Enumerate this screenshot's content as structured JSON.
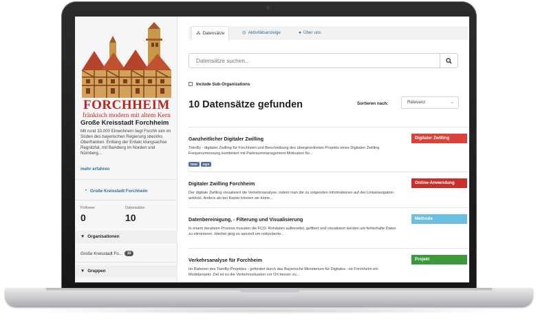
{
  "tabs": [
    {
      "icon": "sitemap-icon",
      "glyph": "⁂",
      "label": "Datensätze"
    },
    {
      "icon": "activity-icon",
      "glyph": "◎",
      "label": "Aktivitätsanzeige"
    },
    {
      "icon": "info-icon",
      "glyph": "●",
      "label": "Über uns"
    }
  ],
  "logo": {
    "wordmark": "FORCHHEIM",
    "tagline": "fränkisch modern mit altem Kern"
  },
  "org": {
    "title": "Große Kreisstadt Forchheim",
    "description": "Mit rund 33.000 Einwohnern liegt Forchh eim im Süden des bayerischen Regierung sbezirks Oberfranken. Entlang der Entwic klungsachse Regnitztal, mit Bamberg im Norden und Nürnberg...",
    "more": "mehr erfahren",
    "link": "Große Kreisstadt Forchheim",
    "followers_label": "Follower",
    "followers": "0",
    "datasets_label": "Datensätze",
    "datasets": "10"
  },
  "facets": {
    "organizations_title": "Organisationen",
    "organization_item": "Große Kreisstadt Fo...",
    "organization_count": "10",
    "groups_title": "Gruppen"
  },
  "search": {
    "placeholder": "Datensätze suchen..."
  },
  "include_label": "Include Sub-Organizations",
  "results_heading": "10 Datensätze gefunden",
  "sort": {
    "label": "Sortieren nach:",
    "value": "Relevanz"
  },
  "results": [
    {
      "title": "Ganzheitlicher Digitaler Zwilling",
      "desc": "TwinBy - digitaler Zwilling für Forchheim und Beschreibung des übergeordneten Projekts eines Digitalen Zwilling Frequenzmessung kombiniert mit Parkraummanagement Motivation für...",
      "tag": "Digitaler Zwilling",
      "tag_color": "#d9433a",
      "formats": [
        "html",
        "mp3"
      ]
    },
    {
      "title": "Digitaler Zwilling Forchheim",
      "desc": "Der digitale Zwilling visualisiert die Verkehrsanalyse, indem man die zu zeigenden Informationen auf der Linkanavigation anklickt. Anders als bei Kepler können wir keine...",
      "tag": "Online-Anwendung",
      "tag_color": "#c9302c",
      "formats": []
    },
    {
      "title": "Datenbereinigung, - Filterung und Visualisierung",
      "desc": "In einem iterativen Prozess mussten die FCD- Rohdaten aufbereitet, gefiltert und visualisiert werden um fehlerhafte Daten zu eliminieren. Hierbei ging es speziell um redundante...",
      "tag": "Methode",
      "tag_color": "#6cbfe0",
      "formats": []
    },
    {
      "title": "Verkehrsanalyse für Forchheim",
      "desc": "Im Rahmen des TwinBy-Projektes - gefördert durch das Bayerische Ministerium für Digitales - ist Forchheim ein Modelprojekt. Ziel ist es die Verkehrssituation vor Ort besser zu...",
      "tag": "Projekt",
      "tag_color": "#3b9a3b",
      "formats": []
    }
  ]
}
